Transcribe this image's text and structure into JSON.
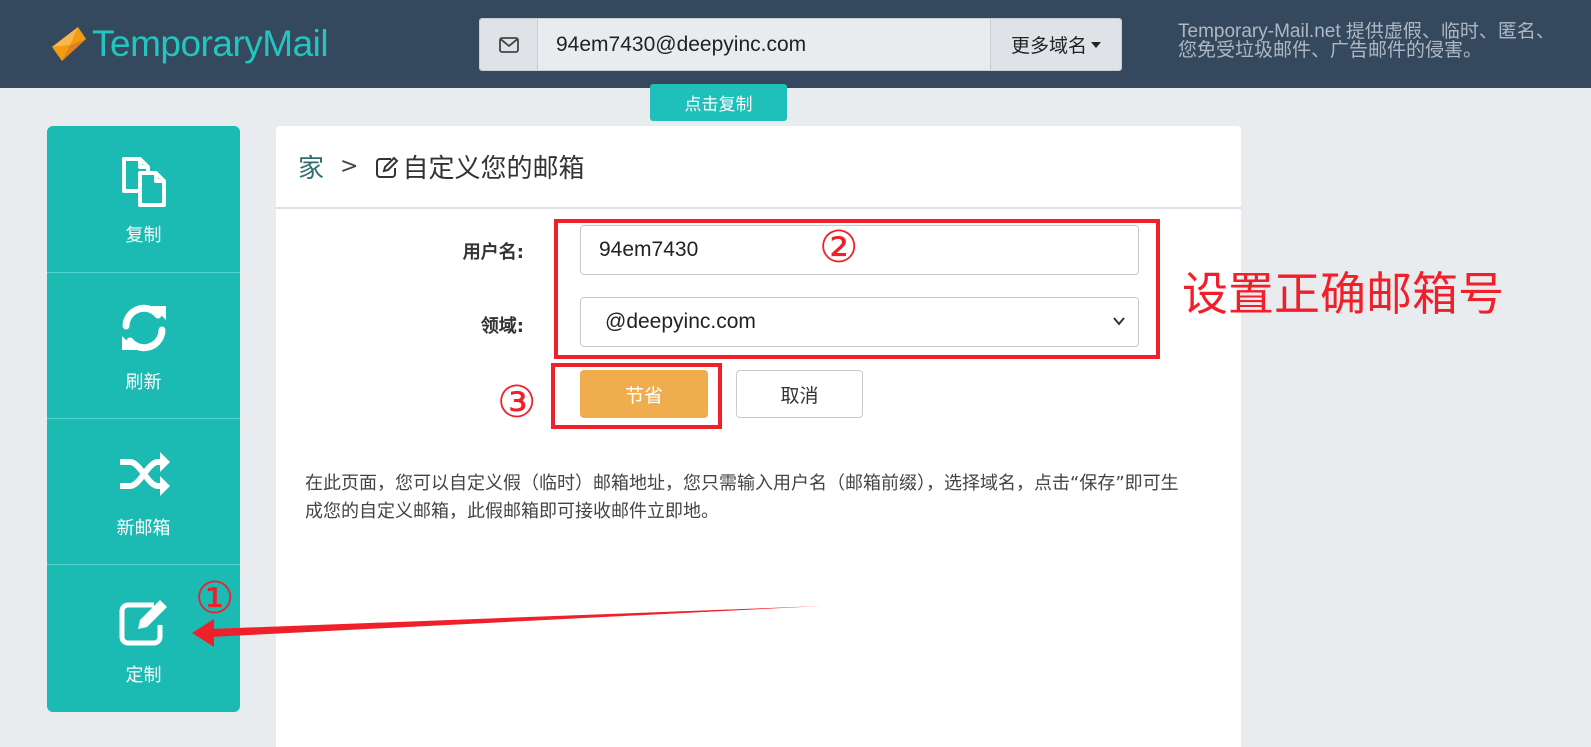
{
  "header": {
    "logo_text": "TemporaryMail",
    "email_address": "94em7430@deepyinc.com",
    "more_domains_label": "更多域名",
    "copy_badge": "点击复制",
    "tagline_line1": "Temporary-Mail.net 提供虚假、临时、匿名、",
    "tagline_line2": "您免受垃圾邮件、广告邮件的侵害。"
  },
  "sidebar": {
    "items": [
      {
        "label": "复制",
        "icon": "copy-icon"
      },
      {
        "label": "刷新",
        "icon": "refresh-icon"
      },
      {
        "label": "新邮箱",
        "icon": "shuffle-icon"
      },
      {
        "label": "定制",
        "icon": "edit-icon"
      }
    ]
  },
  "breadcrumb": {
    "home": "家",
    "separator": ">",
    "current": "自定义您的邮箱"
  },
  "form": {
    "username_label": "用户名:",
    "username_value": "94em7430",
    "domain_label": "领域:",
    "domain_value": "@deepyinc.com",
    "save_label": "节省",
    "cancel_label": "取消"
  },
  "description": "在此页面，您可以自定义假（临时）邮箱地址，您只需输入用户名（邮箱前缀），选择域名，点击“保存”即可生成您的自定义邮箱，此假邮箱即可接收邮件立即地。",
  "annotations": {
    "step1": "①",
    "step2": "②",
    "step3": "③",
    "note": "设置正确邮箱号",
    "color": "#f0202a"
  },
  "colors": {
    "header_bg": "#34495e",
    "accent_teal": "#1bbab3",
    "save_orange": "#f0ad4e"
  }
}
